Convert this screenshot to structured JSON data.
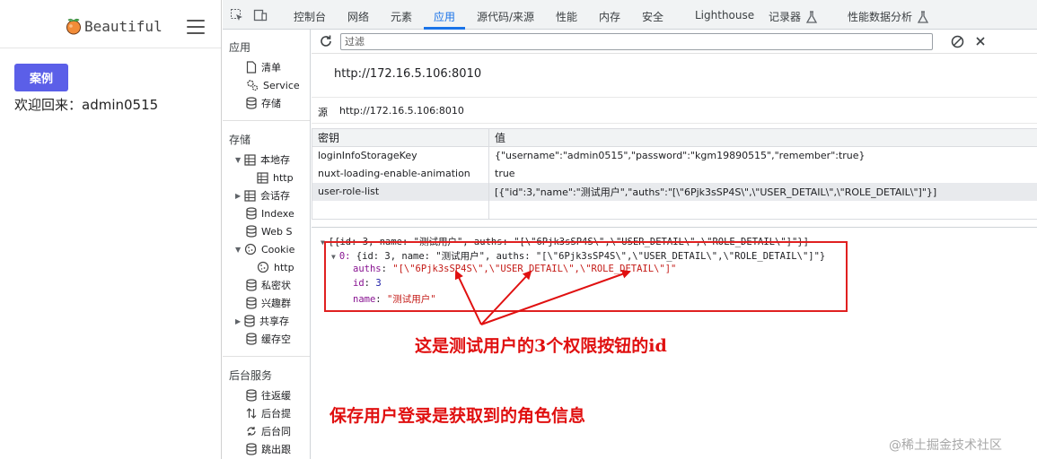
{
  "webpage": {
    "title": "Beautiful",
    "case_button": "案例",
    "welcome": "欢迎回来：admin0515"
  },
  "devtools": {
    "tabs": [
      {
        "label": "控制台",
        "active": false
      },
      {
        "label": "网络",
        "active": false
      },
      {
        "label": "元素",
        "active": false
      },
      {
        "label": "应用",
        "active": true
      },
      {
        "label": "源代码/来源",
        "active": false
      },
      {
        "label": "性能",
        "active": false
      },
      {
        "label": "内存",
        "active": false
      },
      {
        "label": "安全",
        "active": false
      },
      {
        "label": "Lighthouse",
        "active": false
      },
      {
        "label": "记录器",
        "active": false
      },
      {
        "label": "性能数据分析",
        "active": false
      }
    ],
    "sidebar": {
      "section_app": "应用",
      "app_items": [
        "清单",
        "Service",
        "存储"
      ],
      "section_storage": "存储",
      "storage_items": [
        "本地存",
        "http",
        "会话存",
        "Indexe",
        "Web S",
        "Cookie",
        "http",
        "私密状",
        "兴趣群",
        "共享存",
        "缓存空"
      ],
      "section_bg": "后台服务",
      "bg_items": [
        "往返缓",
        "后台提",
        "后台同",
        "跳出跟"
      ]
    },
    "filter_placeholder": "过滤",
    "origin_title": "http://172.16.5.106:8010",
    "origin_label": "源",
    "origin_value": "http://172.16.5.106:8010",
    "table": {
      "headers": [
        "密钥",
        "值"
      ],
      "rows": [
        {
          "key": "loginInfoStorageKey",
          "value": "{\"username\":\"admin0515\",\"password\":\"kgm19890515\",\"remember\":true}"
        },
        {
          "key": "nuxt-loading-enable-animation",
          "value": "true"
        },
        {
          "key": "user-role-list",
          "value": "[{\"id\":3,\"name\":\"测试用户\",\"auths\":\"[\\\"6Pjk3sSP4S\\\",\\\"USER_DETAIL\\\",\\\"ROLE_DETAIL\\\"]\"}]"
        }
      ]
    },
    "preview": {
      "root": "[{id: 3, name: \"测试用户\", auths: \"[\\\"6Pjk3sSP4S\\\",\\\"USER_DETAIL\\\",\\\"ROLE_DETAIL\\\"]\"}]",
      "item_summary_prefix": "0: ",
      "item_summary": "{id: 3, name: \"测试用户\", auths: \"[\\\"6Pjk3sSP4S\\\",\\\"USER_DETAIL\\\",\\\"ROLE_DETAIL\\\"]\"}",
      "auths_key": "auths",
      "auths_value": "\"[\\\"6Pjk3sSP4S\\\",\\\"USER_DETAIL\\\",\\\"ROLE_DETAIL\\\"]\"",
      "id_key": "id",
      "id_value": "3",
      "name_key": "name",
      "name_value": "\"测试用户\""
    }
  },
  "annotations": {
    "note1": "这是测试用户的3个权限按钮的id",
    "note2": "保存用户登录是获取到的角色信息",
    "color": "#e01010"
  },
  "watermark": "@稀土掘金技术社区",
  "colors": {
    "accent": "#1a73e8",
    "button": "#5b5fe8"
  }
}
